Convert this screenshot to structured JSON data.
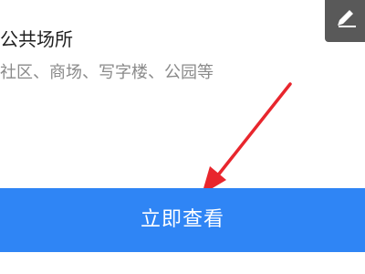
{
  "item": {
    "title": "公共场所",
    "description": "社区、商场、写字楼、公园等"
  },
  "toolbar": {
    "edit_icon": "pencil-icon"
  },
  "cta": {
    "label": "立即查看"
  },
  "colors": {
    "cta_background": "#2f85f5",
    "cta_text": "#ffffff",
    "annotation_arrow": "#e8262d",
    "edit_button_background": "#595959",
    "title_text": "#1f1f1f",
    "description_text": "#8a8a8a"
  }
}
